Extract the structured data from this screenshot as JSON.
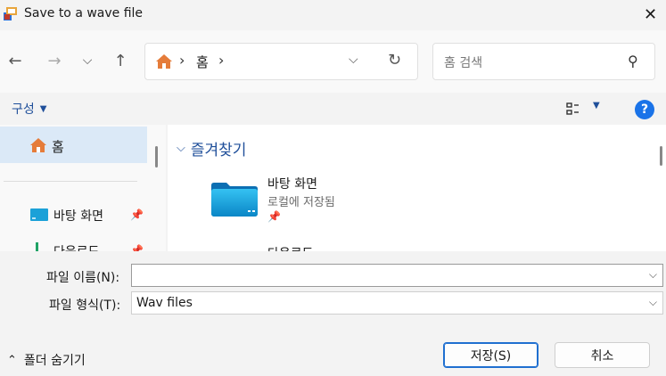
{
  "window": {
    "title": "Save to a wave file",
    "close_glyph": "✕"
  },
  "nav": {
    "back_glyph": "←",
    "forward_glyph": "→",
    "recent_glyph": "⌵",
    "up_glyph": "↑",
    "address": {
      "separator": "›",
      "home_label": "홈",
      "dropdown_glyph": "⌵",
      "refresh_glyph": "↻"
    },
    "search": {
      "placeholder": "홈 검색",
      "icon_glyph": "⚲"
    }
  },
  "toolbar": {
    "organize_label": "구성",
    "caret_glyph": "▼",
    "help_glyph": "?"
  },
  "sidebar": {
    "home_label": "홈",
    "items": [
      {
        "label": "바탕 화면",
        "pinned": true
      },
      {
        "label": "다운로드",
        "pinned": true
      }
    ],
    "pin_glyph": "📌"
  },
  "content": {
    "section_label": "즐겨찾기",
    "chevron_glyph": "⌵",
    "items": [
      {
        "title": "바탕 화면",
        "subtitle": "로컬에 저장됨"
      },
      {
        "title": "다운로드"
      }
    ]
  },
  "fields": {
    "filename_label": "파일 이름(N):",
    "filename_value": "",
    "filetype_label": "파일 형식(T):",
    "filetype_value": "Wav files",
    "dd_glyph": "⌵"
  },
  "footer": {
    "hide_folders_label": "폴더 숨기기",
    "hide_glyph": "⌃",
    "save_label": "저장(S)",
    "cancel_label": "취소"
  },
  "colors": {
    "accent": "#1f4f9a",
    "selection": "#dbe9f7",
    "help_blue": "#1a73e8",
    "primary_border": "#1f6fd0"
  }
}
